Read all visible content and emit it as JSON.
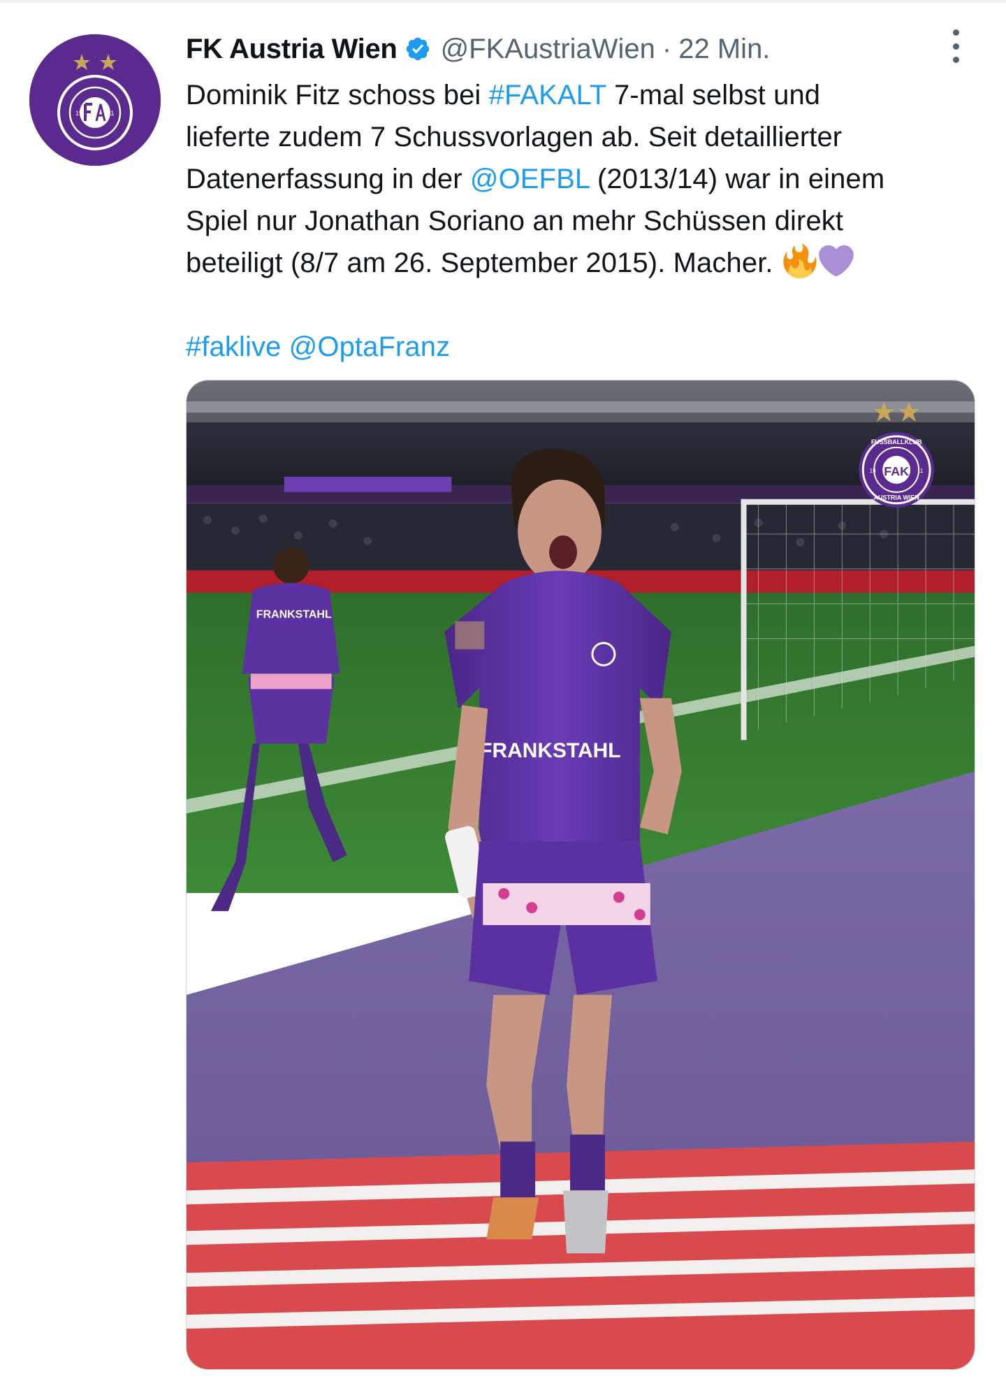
{
  "tweet": {
    "author": {
      "display_name": "FK Austria Wien",
      "handle": "@FKAustriaWien",
      "verified": true,
      "avatar_icon": "fk-austria-wien-crest-icon"
    },
    "separator": "·",
    "timestamp": "22 Min.",
    "text": {
      "line1_before": "Dominik Fitz schoss bei ",
      "line1_hashtag": "#FAKALT",
      "line1_after": " 7-mal selbst und",
      "line2": "lieferte zudem 7 Schussvorlagen ab. Seit detaillierter",
      "line3_before": "Datenerfassung in der ",
      "line3_mention": "@OEFBL",
      "line3_after": " (2013/14) war in einem",
      "line4": "Spiel nur Jonathan Soriano an mehr Schüssen direkt",
      "line5": "beteiligt (8/7 am 26. September 2015). Macher.",
      "emojis": [
        "fire-emoji",
        "purple-heart-emoji"
      ],
      "footer_hashtag": "#faklive",
      "footer_mention": "@OptaFranz"
    },
    "media": {
      "jersey_sponsor": "FRANKSTAHL",
      "crest_text_top": "FUSSBALLKLUB",
      "crest_text_bottom": "AUSTRIA WIEN",
      "crest_letters": "FAK",
      "crest_year_left": "19",
      "crest_year_right": "11"
    }
  },
  "colors": {
    "link": "#1d9bf0",
    "secondary_text": "#536471",
    "club_purple": "#5b2a8f",
    "verified_badge": "#1d9bf0"
  }
}
